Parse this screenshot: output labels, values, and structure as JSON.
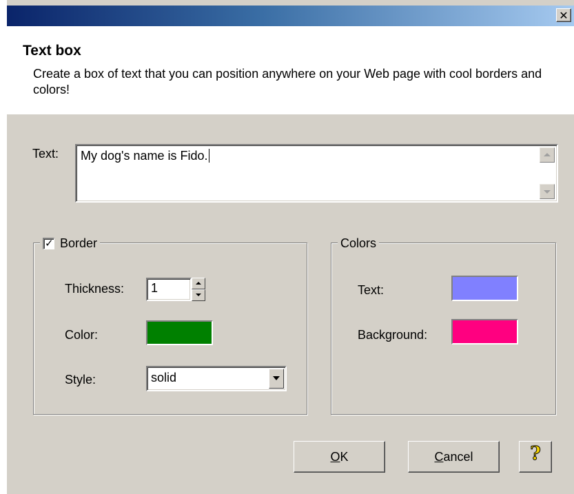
{
  "titlebar": {
    "close_symbol": "✕"
  },
  "header": {
    "title": "Text box",
    "description": "Create a box of text that you can position anywhere on your Web page with cool borders and colors!"
  },
  "text_field": {
    "label": "Text:",
    "value": "My dog's name is Fido."
  },
  "border_group": {
    "label": "Border",
    "checked": true,
    "check_symbol": "✓",
    "thickness_label": "Thickness:",
    "thickness_value": "1",
    "color_label": "Color:",
    "color_value": "#008000",
    "style_label": "Style:",
    "style_value": "solid"
  },
  "colors_group": {
    "label": "Colors",
    "text_label": "Text:",
    "text_color": "#8080ff",
    "background_label": "Background:",
    "background_color": "#ff0080"
  },
  "buttons": {
    "ok_mnemonic": "O",
    "ok_rest": "K",
    "cancel_mnemonic": "C",
    "cancel_rest": "ancel",
    "help_symbol": "?"
  },
  "icons": {
    "close": "close-icon",
    "scroll_up": "scroll-up-arrow-icon",
    "scroll_down": "scroll-down-arrow-icon",
    "spin_up": "spin-up-arrow-icon",
    "spin_down": "spin-down-arrow-icon",
    "dropdown": "dropdown-arrow-icon",
    "help": "help-question-icon"
  },
  "theme": {
    "face": "#d4d0c8",
    "title_gradient_start": "#0a246a",
    "title_gradient_end": "#a6caf0"
  }
}
